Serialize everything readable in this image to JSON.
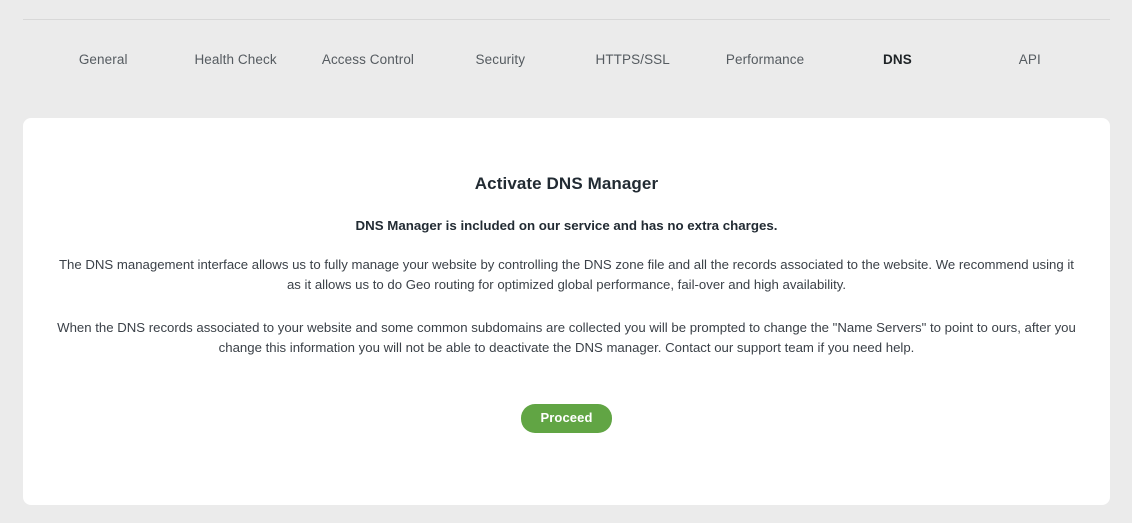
{
  "tabs": [
    {
      "label": "General",
      "active": false
    },
    {
      "label": "Health Check",
      "active": false
    },
    {
      "label": "Access Control",
      "active": false
    },
    {
      "label": "Security",
      "active": false
    },
    {
      "label": "HTTPS/SSL",
      "active": false
    },
    {
      "label": "Performance",
      "active": false
    },
    {
      "label": "DNS",
      "active": true
    },
    {
      "label": "API",
      "active": false
    }
  ],
  "panel": {
    "title": "Activate DNS Manager",
    "subtitle": "DNS Manager is included on our service and has no extra charges.",
    "paragraph1": "The DNS management interface allows us to fully manage your website by controlling the DNS zone file and all the records associated to the website. We recommend using it as it allows us to do Geo routing for optimized global performance, fail-over and high availability.",
    "paragraph2": "When the DNS records associated to your website and some common subdomains are collected you will be prompted to change the \"Name Servers\" to point to ours, after you change this information you will not be able to deactivate the DNS manager. Contact our support team if you need help.",
    "proceed_label": "Proceed"
  },
  "colors": {
    "page_background": "#ebebeb",
    "card_background": "#ffffff",
    "rule": "#d8d8d8",
    "tab_inactive": "#555b60",
    "tab_active": "#1e2326",
    "heading": "#222b33",
    "body_text": "#3b4148",
    "accent_green": "#61a544",
    "button_text": "#ffffff"
  }
}
